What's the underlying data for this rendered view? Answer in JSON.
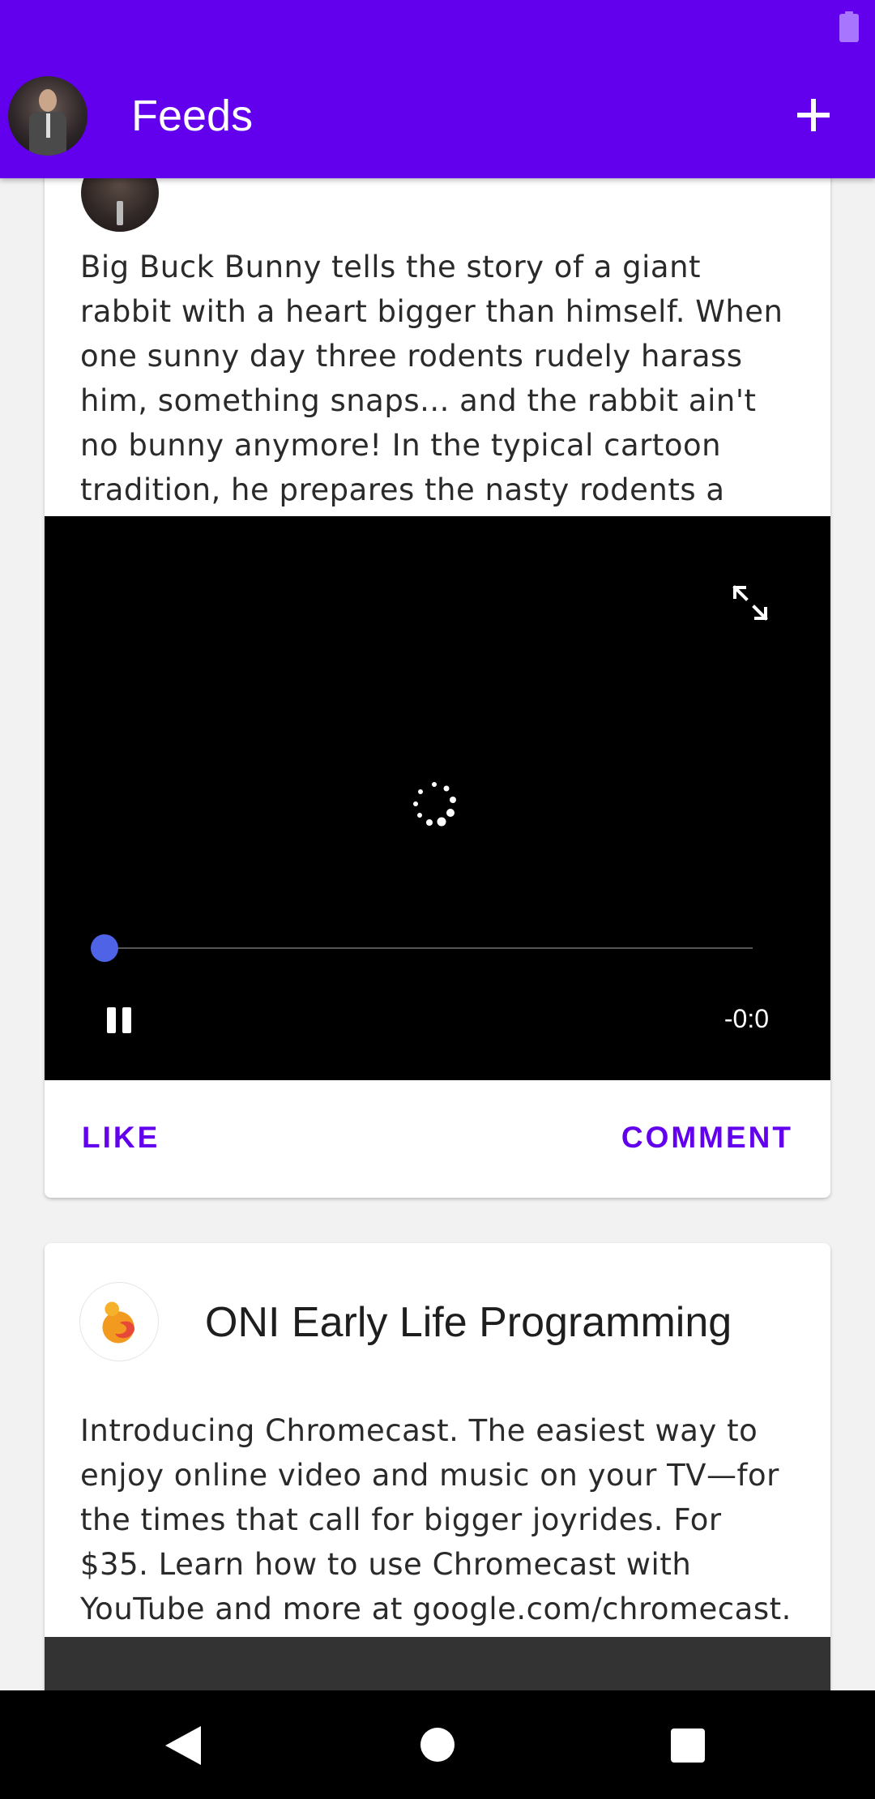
{
  "app_bar": {
    "title": "Feeds",
    "add_icon": "plus-icon",
    "color": "#6200ee"
  },
  "posts": [
    {
      "text": "Big Buck Bunny tells the story of a giant rabbit with a heart bigger than himself. When one sunny day three rodents rudely harass him, something snaps... and the rabbit ain't no bunny anymore! In the typical cartoon tradition, he prepares the nasty rodents a comical revenge.",
      "video": {
        "time_remaining": "-0:0",
        "progress": 0,
        "state": "loading",
        "seek_color": "#4e63e6"
      },
      "actions": {
        "like": "LIKE",
        "comment": "COMMENT"
      }
    },
    {
      "author": "ONI Early Life Programming",
      "text": "Introducing Chromecast. The easiest way to enjoy online video and music on your TV—for the times that call for bigger joyrides. For $35. Learn how to use Chromecast with YouTube and more at google.com/chromecast."
    }
  ],
  "nav": {
    "back_icon": "back-triangle-icon",
    "home_icon": "home-circle-icon",
    "recents_icon": "recents-square-icon"
  }
}
